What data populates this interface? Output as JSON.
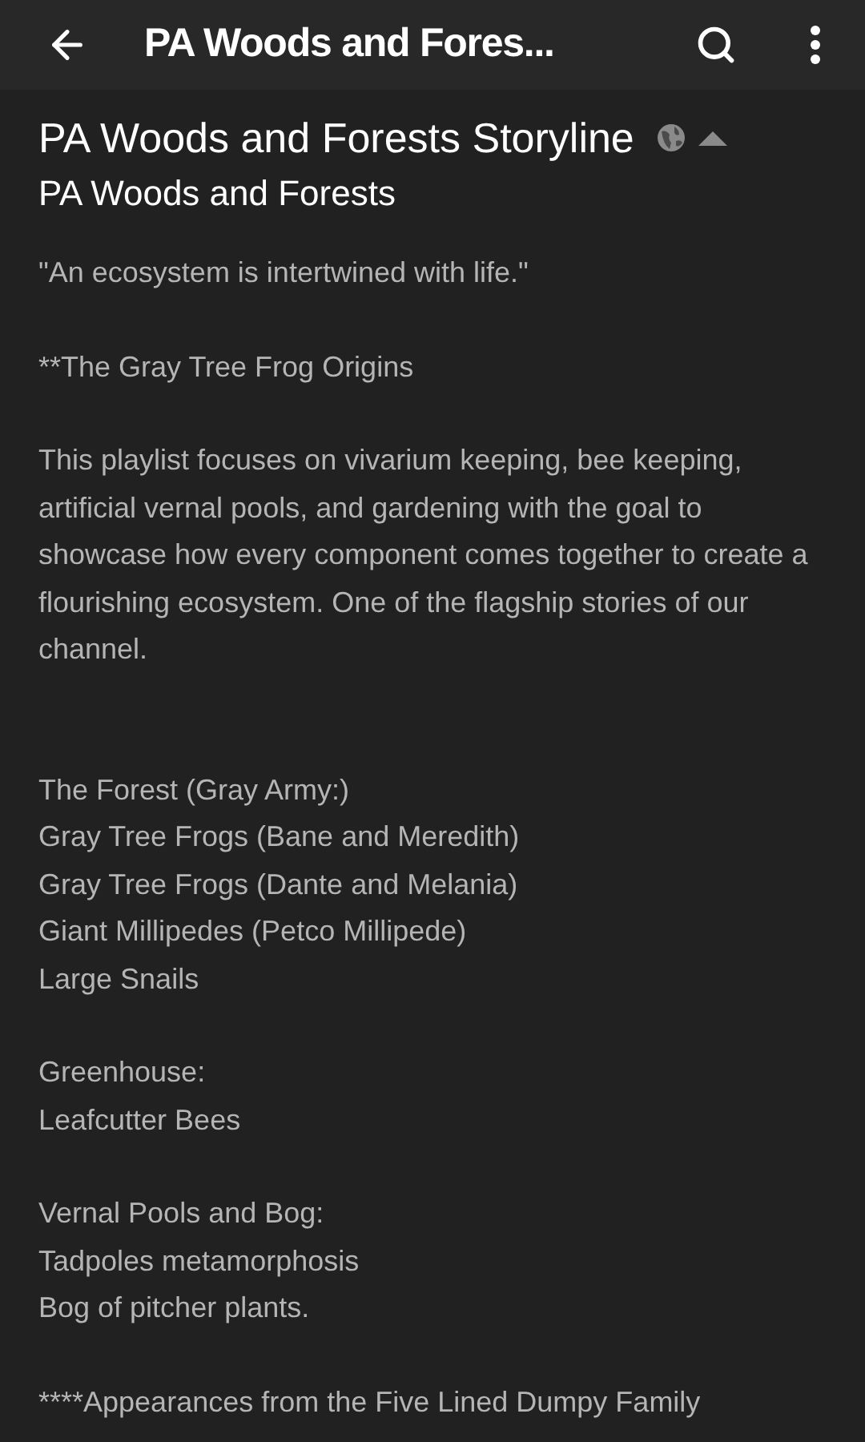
{
  "app_bar": {
    "title": "PA Woods and Fores..."
  },
  "header": {
    "title": "PA Woods and Forests Storyline",
    "channel": "PA Woods and Forests",
    "expanded": true
  },
  "description": [
    {
      "lines": [
        "\"An ecosystem is intertwined with life.\""
      ]
    },
    {
      "lines": [
        "**The Gray Tree Frog Origins"
      ]
    },
    {
      "lines": [
        "This playlist focuses on vivarium keeping, bee keeping, artificial vernal pools, and gardening with the goal to showcase how every component comes together to create a flourishing ecosystem. One of the flagship stories of our channel."
      ]
    },
    {
      "lines": [
        "The Forest (Gray Army:)",
        "Gray Tree Frogs (Bane and Meredith)",
        "Gray Tree Frogs (Dante and Melania)",
        "Giant Millipedes (Petco Millipede)",
        "Large Snails"
      ]
    },
    {
      "lines": [
        "Greenhouse:",
        "Leafcutter Bees"
      ]
    },
    {
      "lines": [
        "Vernal Pools and Bog:",
        "Tadpoles metamorphosis",
        "Bog of pitcher plants."
      ]
    },
    {
      "lines": [
        "****Appearances from the Five Lined Dumpy Family"
      ]
    }
  ]
}
